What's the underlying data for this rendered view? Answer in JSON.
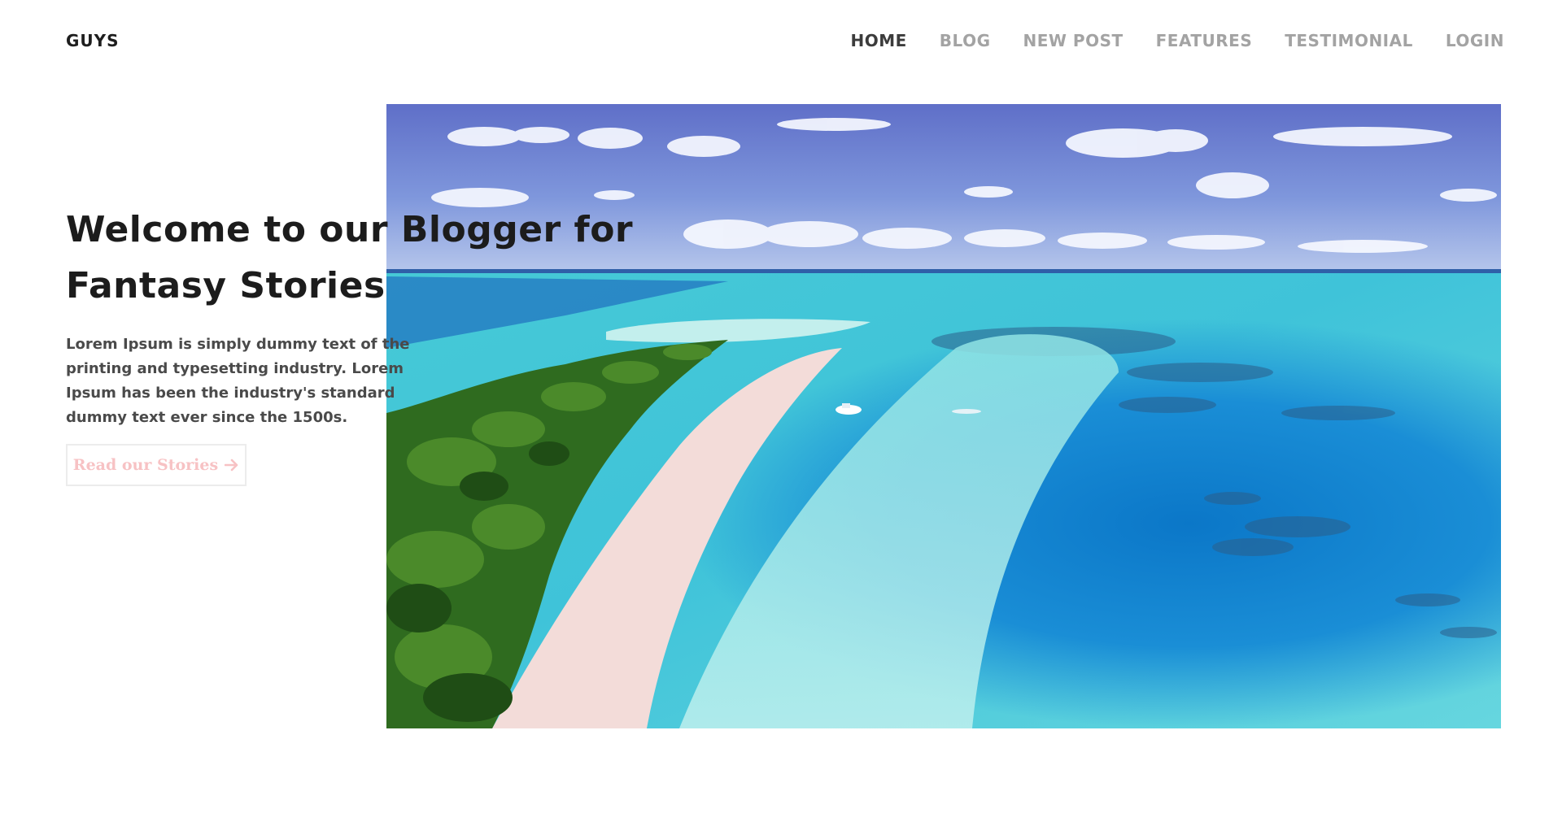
{
  "header": {
    "logo": "GUYS",
    "nav": [
      {
        "label": "HOME",
        "active": true
      },
      {
        "label": "BLOG",
        "active": false
      },
      {
        "label": "NEW POST",
        "active": false
      },
      {
        "label": "FEATURES",
        "active": false
      },
      {
        "label": "TESTIMONIAL",
        "active": false
      },
      {
        "label": "LOGIN",
        "active": false
      }
    ]
  },
  "hero": {
    "title": "Welcome to our Blogger for Fantasy Stories",
    "description": "Lorem Ipsum is simply dummy text of the printing and typesetting industry. Lorem Ipsum has been the industry's standard dummy text ever since the 1500s.",
    "cta_label": "Read our Stories",
    "cta_icon": "arrow-right-icon",
    "image": "tropical-island-beach-aerial-photo"
  },
  "colors": {
    "nav_active": "#3c3c3c",
    "nav_inactive": "#a3a3a3",
    "cta_text": "#f7c2c4",
    "title": "#1c1c1c"
  }
}
